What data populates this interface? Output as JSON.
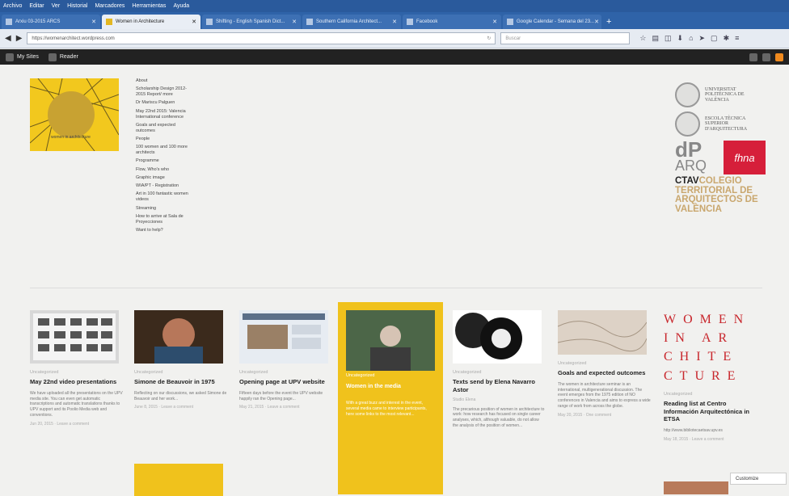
{
  "browser": {
    "menu": [
      "Archivo",
      "Editar",
      "Ver",
      "Historial",
      "Marcadores",
      "Herramientas",
      "Ayuda"
    ],
    "tabs": [
      {
        "label": "Arxiu 03-2015 ARCS"
      },
      {
        "label": "Women in Architecture",
        "active": true
      },
      {
        "label": "Shifting - English Spanish Dict..."
      },
      {
        "label": "Southern California Architect..."
      },
      {
        "label": "Facebook"
      },
      {
        "label": "Google Calendar - Semana del 23..."
      }
    ],
    "url": "https://womenarchitect.wordpress.com",
    "search_placeholder": "Buscar"
  },
  "wp_bar": {
    "my_sites": "My Sites",
    "reader": "Reader"
  },
  "site": {
    "logo_text": "women in architecture",
    "nav": [
      "About",
      "Scholarship Design 2012-2015 Report/ more",
      "Dr Mariscu Palguen",
      "May 22nd 2015: Valencia International conference",
      "Goals and expected outcomes",
      "People",
      "100 women and 100 more architects",
      "Programme",
      "Flow, Who's who",
      "Graphic image",
      "WIA/PT - Registration",
      "Art in 100 fantastic women videos",
      "Streaming",
      "How to arrive at Sala de Proyecciones",
      "Want to help?"
    ],
    "partners": {
      "upv": "UNIVERSITAT POLITÈCNICA DE VALÈNCIA",
      "etsa": "ESCOLA TÈCNICA SUPERIOR D'ARQUITECTURA",
      "dp": "dP",
      "arq": "ARQ",
      "fhna": "fhna",
      "ctav_1": "CTAV",
      "ctav_2": "COLEGIO TERRITORIAL DE ARQUITECTOS DE VALÈNCIA"
    }
  },
  "cards": [
    {
      "category": "Uncategorized",
      "title": "May 22nd video presentations",
      "excerpt": "We have uploaded all the presentations on the UPV media site. You can even get automatic transcriptions and automatic translations thanks to UPV support and its Poolio Media web and conventions.",
      "meta": "Jun 20, 2015 · Leave a comment"
    },
    {
      "category": "Uncategorized",
      "title": "Simone de Beauvoir in 1975",
      "excerpt": "Reflecting on our discussions, we asked Simone de Beauvoir and her work...",
      "meta": "June 8, 2015 · Leave a comment"
    },
    {
      "category": "Uncategorized",
      "title": "Opening page at UPV website",
      "excerpt": "Fifteen days before the event the UPV website happily ran the Opening page...",
      "meta": "May 21, 2015 · Leave a comment"
    },
    {
      "category": "Uncategorized",
      "title": "Women in the media",
      "excerpt": "With a great buzz and interest in the event, several media came to interview participants, here some links to the most relevant..."
    },
    {
      "category": "Uncategorized",
      "title": "Texts send by Elena Navarro Astor",
      "excerpt": "The precarious position of women in architecture to work: how research has focused on single career analyses, which, although valuable, do not allow the analysis of the position of women...",
      "meta": "Studio Elena"
    },
    {
      "category": "Uncategorized",
      "title": "Goals and expected outcomes",
      "excerpt": "The women in architecture seminar is an international, multigenerational discussion. The event emerges from the 1975 edition of NO conferences in Valencia and aims to express a wide range of work from across the globe.",
      "meta": "May 20, 2015 · One comment"
    },
    {
      "category": "Uncategorized",
      "title": "Reading list at Centro Información Arquitectónica in ETSA",
      "excerpt": "http://www.bibliotecaetsav.upv.es",
      "meta": "May 18, 2015 · Leave a comment"
    }
  ],
  "women_poster": [
    "WOMEN",
    "IN AR",
    "CHITE",
    "CTURE"
  ],
  "follow_label": "Customize"
}
